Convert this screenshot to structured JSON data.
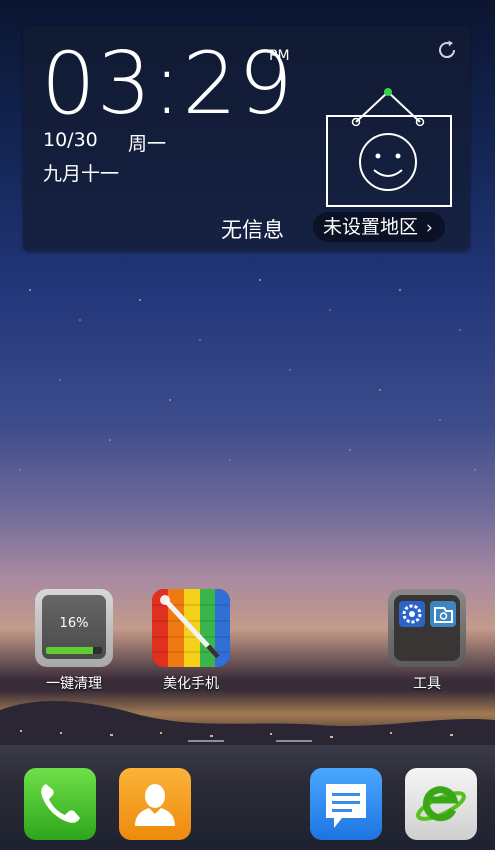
{
  "clock": {
    "time": "03:29",
    "ampm": "PM",
    "date": "10/30",
    "weekday": "周一",
    "lunar": "九月十一"
  },
  "weather": {
    "status": "无信息",
    "region": "未设置地区",
    "chevron": "›"
  },
  "apps": [
    {
      "label": "一键清理",
      "percent": "16%",
      "fill_fraction": 0.16
    },
    {
      "label": "美化手机"
    },
    {
      "label": "工具"
    }
  ],
  "dock": [
    {
      "name": "phone",
      "color": "#3fbf20"
    },
    {
      "name": "contacts",
      "color": "#f39a17"
    },
    {
      "name": "messages",
      "color": "#2d8ef0"
    },
    {
      "name": "browser",
      "color": "#e8e8e8"
    }
  ],
  "colors": {
    "widget_bg": "#141c32",
    "accent_green": "#5fcf2f",
    "sign_dot": "#3ed14a"
  }
}
